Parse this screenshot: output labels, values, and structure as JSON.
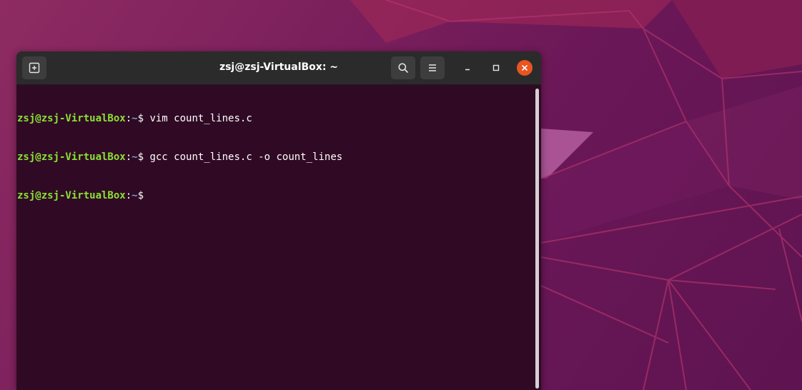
{
  "window": {
    "title": "zsj@zsj-VirtualBox: ~"
  },
  "icons": {
    "new_tab": "new-tab-icon",
    "search": "search-icon",
    "menu": "hamburger-menu-icon",
    "minimize": "minimize-icon",
    "maximize": "maximize-icon",
    "close": "close-icon"
  },
  "colors": {
    "terminal_bg": "#300a24",
    "prompt_user": "#8ae234",
    "prompt_path": "#729fcf",
    "close_button": "#e95420"
  },
  "terminal": {
    "lines": [
      {
        "user": "zsj@zsj-VirtualBox",
        "sep": ":",
        "path": "~",
        "prompt": "$ ",
        "command": "vim count_lines.c"
      },
      {
        "user": "zsj@zsj-VirtualBox",
        "sep": ":",
        "path": "~",
        "prompt": "$ ",
        "command": "gcc count_lines.c -o count_lines"
      },
      {
        "user": "zsj@zsj-VirtualBox",
        "sep": ":",
        "path": "~",
        "prompt": "$ ",
        "command": ""
      }
    ]
  }
}
